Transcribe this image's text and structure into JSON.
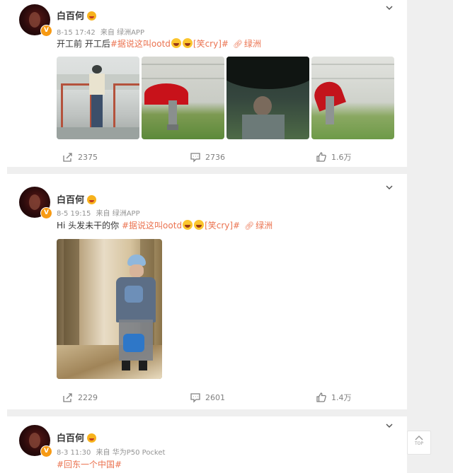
{
  "posts": [
    {
      "author": "白百何",
      "date": "8-15 17:42",
      "source": "来自 绿洲APP",
      "text_before": "开工前 开工后",
      "topic": "#据说这叫ootd",
      "bracket_emoji": "[笑cry]#",
      "link_label": "绿洲",
      "reposts": "2375",
      "comments": "2736",
      "likes": "1.6万"
    },
    {
      "author": "白百何",
      "date": "8-5 19:15",
      "source": "来自 绿洲APP",
      "text_before": "Hi 头发未干的你 ",
      "topic": "#据说这叫ootd",
      "bracket_emoji": "[笑cry]#",
      "link_label": "绿洲",
      "reposts": "2229",
      "comments": "2601",
      "likes": "1.4万"
    },
    {
      "author": "白百何",
      "date": "8-3 11:30",
      "source": "来自 华为P50 Pocket",
      "text_partial": "#回东一个中国#"
    }
  ],
  "verified_badge": "V",
  "top_button_label": "TOP",
  "icons": {
    "repost": "repost-icon",
    "comment": "comment-icon",
    "like": "thumbs-up-icon",
    "link": "link-icon",
    "menu": "chevron-down-icon",
    "top": "back-to-top-icon"
  },
  "colors": {
    "topic": "#eb7350",
    "meta": "#939393",
    "separator": "#efefef",
    "badge": "#f79a13"
  }
}
